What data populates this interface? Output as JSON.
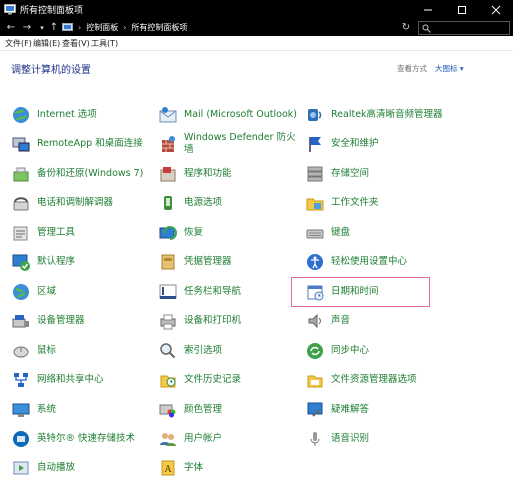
{
  "window": {
    "title": "所有控制面板项"
  },
  "address": {
    "crumbs": [
      "控制面板",
      "所有控制面板项"
    ]
  },
  "menu": [
    "文件(F)",
    "编辑(E)",
    "查看(V)",
    "工具(T)"
  ],
  "heading": "调整计算机的设置",
  "view_by": {
    "label": "查看方式",
    "value": "大图标 ▾"
  },
  "items": [
    {
      "label": "Internet 选项",
      "icon": "globe-icon"
    },
    {
      "label": "Mail (Microsoft Outlook)",
      "icon": "mail-icon"
    },
    {
      "label": "Realtek高清晰音频管理器",
      "icon": "audio-icon"
    },
    {
      "label": "RemoteApp 和桌面连接",
      "icon": "remote-desktop-icon"
    },
    {
      "label": "Windows Defender 防火墙",
      "label_lines": [
        "Windows Defender 防火",
        "墙"
      ],
      "icon": "firewall-icon"
    },
    {
      "label": "安全和维护",
      "icon": "flag-icon"
    },
    {
      "label": "备份和还原(Windows 7)",
      "icon": "backup-icon"
    },
    {
      "label": "程序和功能",
      "icon": "programs-icon"
    },
    {
      "label": "存储空间",
      "icon": "storage-icon"
    },
    {
      "label": "电话和调制解调器",
      "icon": "phone-icon"
    },
    {
      "label": "电源选项",
      "icon": "power-icon"
    },
    {
      "label": "工作文件夹",
      "icon": "folder-icon"
    },
    {
      "label": "管理工具",
      "icon": "tools-icon"
    },
    {
      "label": "恢复",
      "icon": "recovery-icon"
    },
    {
      "label": "键盘",
      "icon": "keyboard-icon"
    },
    {
      "label": "默认程序",
      "icon": "default-programs-icon"
    },
    {
      "label": "凭据管理器",
      "icon": "credentials-icon"
    },
    {
      "label": "轻松使用设置中心",
      "icon": "ease-of-access-icon"
    },
    {
      "label": "区域",
      "icon": "region-icon"
    },
    {
      "label": "任务栏和导航",
      "icon": "taskbar-icon"
    },
    {
      "label": "日期和时间",
      "icon": "calendar-icon"
    },
    {
      "label": "设备管理器",
      "icon": "device-manager-icon"
    },
    {
      "label": "设备和打印机",
      "icon": "printer-icon"
    },
    {
      "label": "声音",
      "icon": "speaker-icon"
    },
    {
      "label": "鼠标",
      "icon": "mouse-icon"
    },
    {
      "label": "索引选项",
      "icon": "index-icon"
    },
    {
      "label": "同步中心",
      "icon": "sync-icon"
    },
    {
      "label": "网络和共享中心",
      "icon": "network-icon"
    },
    {
      "label": "文件历史记录",
      "icon": "file-history-icon"
    },
    {
      "label": "文件资源管理器选项",
      "icon": "explorer-options-icon"
    },
    {
      "label": "系统",
      "icon": "system-icon"
    },
    {
      "label": "颜色管理",
      "icon": "color-icon"
    },
    {
      "label": "疑难解答",
      "icon": "troubleshoot-icon"
    },
    {
      "label": "英特尔® 快速存储技术",
      "icon": "intel-storage-icon"
    },
    {
      "label": "用户帐户",
      "icon": "users-icon"
    },
    {
      "label": "语音识别",
      "icon": "microphone-icon"
    },
    {
      "label": "自动播放",
      "icon": "autoplay-icon"
    },
    {
      "label": "字体",
      "icon": "font-icon"
    }
  ],
  "highlighted_item": "日期和时间",
  "colors": {
    "link": "#1e7d32",
    "heading": "#1e3287",
    "highlight": "#e2708d"
  }
}
